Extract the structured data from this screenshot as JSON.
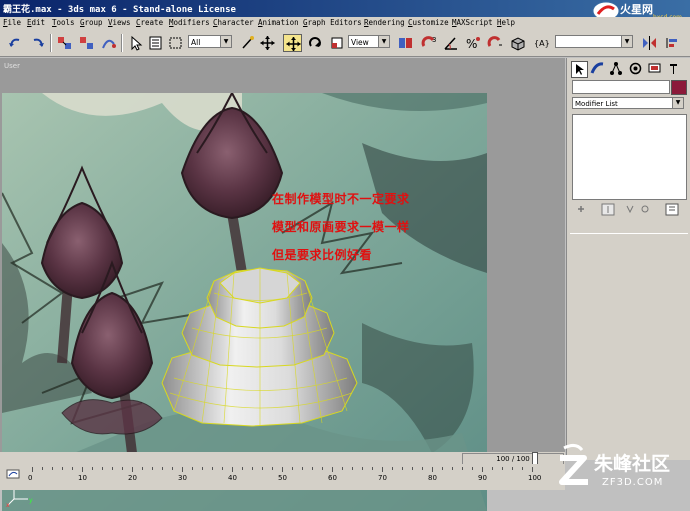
{
  "window": {
    "title": "霸王花.max - 3ds max 6 - Stand-alone License",
    "top_logo": "火星网",
    "top_logo_url": "hxsd.com"
  },
  "menu": [
    "File",
    "Edit",
    "Tools",
    "Group",
    "Views",
    "Create",
    "Modifiers",
    "Character",
    "Animation",
    "Graph Editors",
    "Rendering",
    "Customize",
    "MAXScript",
    "Help"
  ],
  "toolbar": {
    "selection_filter": "All",
    "ref_coord": "View"
  },
  "viewport": {
    "label": "User",
    "note_lines": [
      "在制作模型时不一定要求",
      "模型和原画要求一模一样",
      "但是要求比例好看"
    ]
  },
  "command_panel": {
    "modifier_list": "Modifier List",
    "object_color": "#8b1a3a"
  },
  "timeline": {
    "frame_counter": "100 / 100",
    "ticks": [
      "0",
      "10",
      "20",
      "30",
      "40",
      "50",
      "60",
      "70",
      "80",
      "90",
      "100"
    ],
    "progress": 1.0
  },
  "watermark": {
    "brand": "朱峰社区",
    "url": "ZF3D.COM"
  }
}
